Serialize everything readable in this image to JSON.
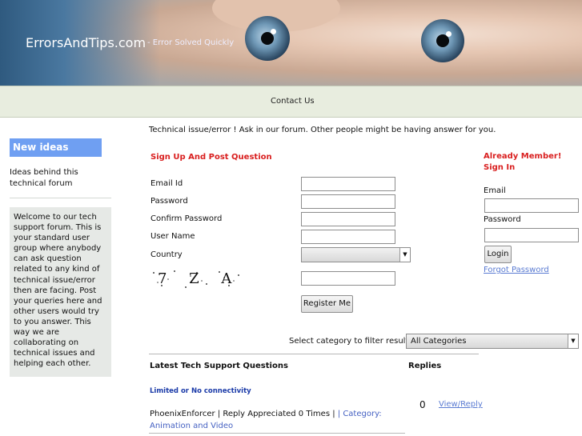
{
  "header": {
    "site_title": "ErrorsAndTips.com",
    "tagline": " - Error Solved Quickly"
  },
  "nav": {
    "contact": "Contact Us"
  },
  "sidebar": {
    "heading": "New ideas",
    "ideas_text": "Ideas behind this technical forum",
    "welcome_text": "Welcome to our tech support forum. This is your standard user group where anybody can ask question related to any kind of technical issue/error then are facing. Post your queries here and other users would try to you answer. This way we are collaborating on technical issues and helping each other."
  },
  "main": {
    "intro": "Technical issue/error ! Ask in our forum. Other people might be having answer for you."
  },
  "signup": {
    "heading": "Sign Up And Post Question",
    "email_label": "Email Id",
    "password_label": "Password",
    "confirm_label": "Confirm Password",
    "username_label": "User Name",
    "country_label": "Country",
    "country_value": "",
    "captcha_text": "7 Z A",
    "register_button": "Register Me"
  },
  "login": {
    "heading": "Already Member! Sign In",
    "email_label": "Email",
    "password_label": "Password",
    "login_button": "Login",
    "forgot_link": "Forgot Password"
  },
  "filter": {
    "label": "Select category to filter results",
    "selected": "All Categories"
  },
  "questions": {
    "header": "Latest Tech Support Questions",
    "replies_header": "Replies",
    "items": [
      {
        "title": "Limited or No connectivity",
        "meta": "PhoenixEnforcer | Reply Appreciated 0 Times | ",
        "category": "| Category: Animation and Video",
        "replies": "0",
        "action": "View/Reply"
      }
    ]
  },
  "colors": {
    "accent_red": "#d91f1f",
    "sidebar_blue": "#6f9ff2",
    "link_blue": "#5a7bd2",
    "nav_bg": "#e8eddf"
  }
}
